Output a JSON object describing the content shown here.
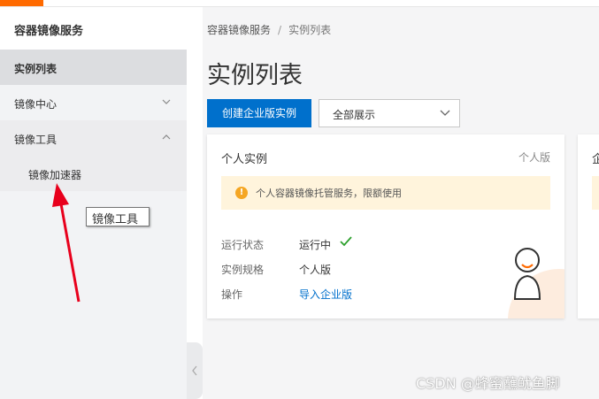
{
  "sidebar": {
    "title": "容器镜像服务",
    "items": [
      {
        "label": "实例列表"
      },
      {
        "label": "镜像中心"
      },
      {
        "label": "镜像工具"
      },
      {
        "label": "镜像加速器"
      }
    ]
  },
  "tooltip": {
    "text": "镜像工具"
  },
  "breadcrumb": {
    "root": "容器镜像服务",
    "separator": "/",
    "current": "实例列表"
  },
  "main": {
    "title": "实例列表",
    "create_button": "创建企业版实例",
    "filter_select": "全部展示"
  },
  "card": {
    "title": "个人实例",
    "tag": "个人版",
    "notice": "个人容器镜像托管服务，限额使用",
    "rows": [
      {
        "label": "运行状态",
        "value": "运行中"
      },
      {
        "label": "实例规格",
        "value": "个人版"
      },
      {
        "label": "操作",
        "value": "导入企业版"
      }
    ]
  },
  "card2": {
    "title_partial": "企"
  },
  "watermark": "CSDN @蜂蜜蘸鱿鱼脚",
  "colors": {
    "accent": "#ff6a00",
    "primary": "#0070cc",
    "warning": "#f5a623",
    "success": "#2ca02c"
  }
}
